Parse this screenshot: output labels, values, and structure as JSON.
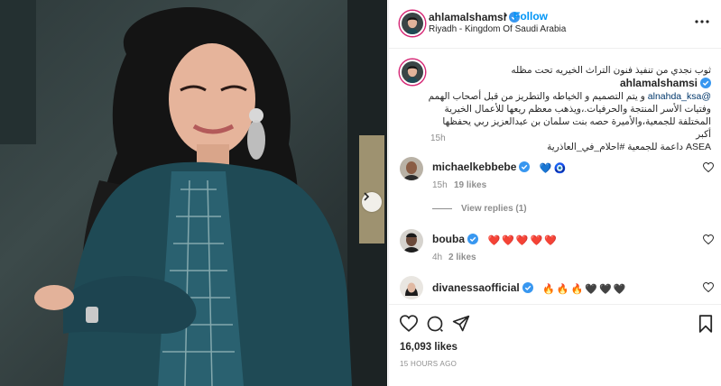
{
  "post": {
    "author": "ahlamalshamsi",
    "follow_label": "Follow",
    "separator": "•",
    "location": "Riyadh - Kingdom Of Saudi Arabia",
    "caption_author": "ahlamalshamsi",
    "caption_lines": [
      "ثوب نجدي من تنفيذ فنون التراث الخيريه تحت مظله",
      "@alnahda_ksa و يتم التصميم و الخياطه والتطريز من قبل أصحاب الهمم",
      "وفتيات الأسر المنتجة والحرفيات.،ويذهب معظم ريعها للأعمال الخيرية",
      "المختلفة للجمعية،والأميرة حصه بنت سلمان بن عبدالعزيز ربي يحفظها أكبر",
      "ASEA داعمة للجمعية #احلام_في_العاذرية"
    ],
    "caption_mention": "@alnahda_ksa",
    "caption_time": "15h",
    "likes": "16,093 likes",
    "timestamp": "15 HOURS AGO"
  },
  "comments": [
    {
      "user": "michaelkebbebe",
      "emojis": [
        "💙",
        "🧿"
      ],
      "time": "15h",
      "likes": "19 likes",
      "view_replies": "View replies (1)"
    },
    {
      "user": "bouba",
      "emojis": [
        "❤️",
        "❤️",
        "❤️",
        "❤️",
        "❤️"
      ],
      "time": "4h",
      "likes": "2 likes"
    },
    {
      "user": "divanessaofficial",
      "emojis": [
        "🔥",
        "🔥",
        "🔥",
        "🖤",
        "🖤",
        "🖤"
      ]
    }
  ],
  "icons": {
    "verified": "verified-badge-icon",
    "more": "more-options-icon",
    "heart": "heart-icon",
    "comment": "comment-icon",
    "share": "share-icon",
    "save": "bookmark-icon",
    "next": "chevron-right-icon"
  },
  "colors": {
    "accent": "#0095f6",
    "verified": "#3897f0",
    "muted": "#8e8e8e",
    "mention": "#00376b",
    "heart_red": "#ed4956"
  }
}
